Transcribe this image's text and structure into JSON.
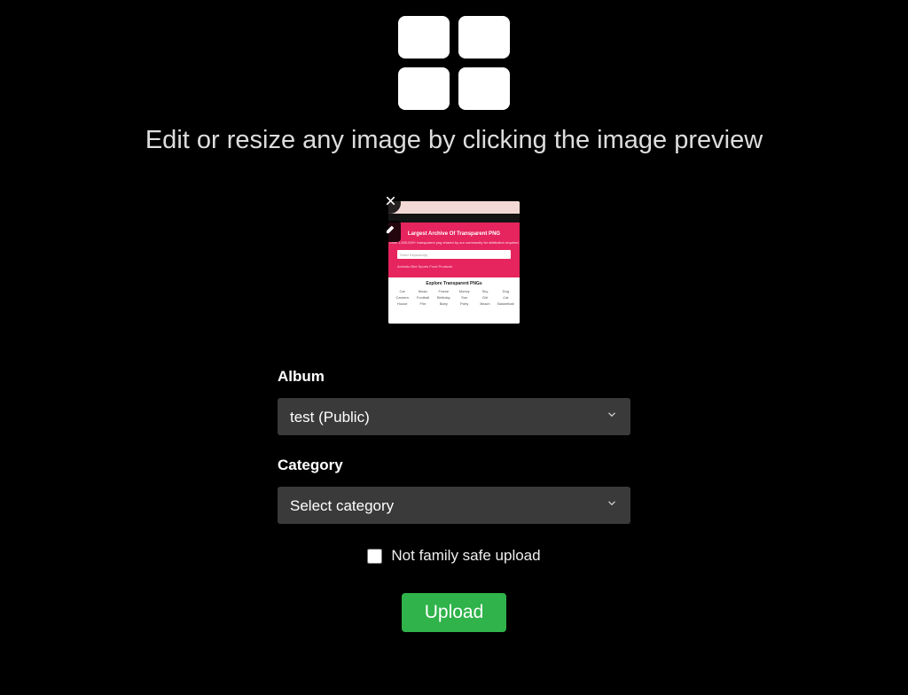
{
  "headline": "Edit or resize any image by clicking the image preview",
  "thumbnail": {
    "hero_title": "Largest Archive Of Transparent PNG",
    "hero_sub": "Over 1,000,000+ transparent png shared by our community for attribution required",
    "search_placeholder": "Enter Keyword(s)",
    "hero_tags": "Animals  Bird  Sports  Food  Products",
    "body_title": "Explore Transparent PNGs",
    "grid": [
      "Car",
      "Music",
      "Frame",
      "Money",
      "Sky",
      "Dog",
      "Camera",
      "Football",
      "Birthday",
      "Sun",
      "Girl",
      "Cat",
      "House",
      "Fire",
      "Baby",
      "Party",
      "Beach",
      "Basketball"
    ]
  },
  "form": {
    "album_label": "Album",
    "album_value": "test (Public)",
    "category_label": "Category",
    "category_value": "Select category",
    "nsfw_label": "Not family safe upload",
    "upload_label": "Upload"
  }
}
